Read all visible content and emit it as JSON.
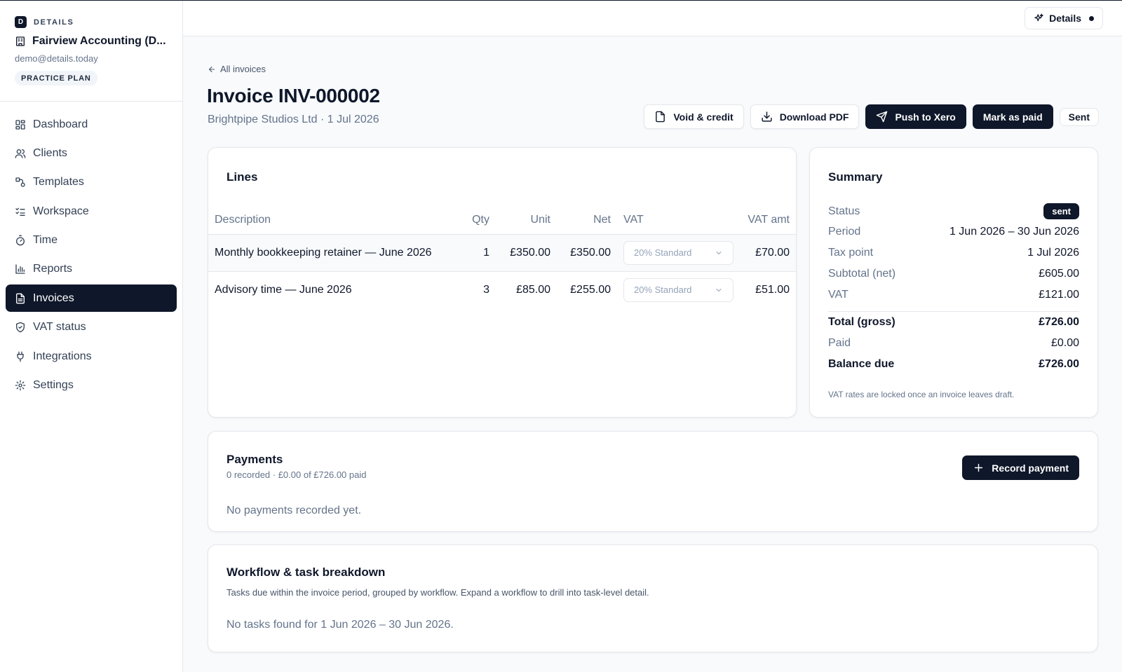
{
  "brand": {
    "logo_letter": "D",
    "name": "DETAILS"
  },
  "org": {
    "name": "Fairview Accounting (D...",
    "email": "demo@details.today",
    "plan": "PRACTICE PLAN"
  },
  "nav": [
    {
      "label": "Dashboard",
      "icon": "dashboard-icon"
    },
    {
      "label": "Clients",
      "icon": "users-icon"
    },
    {
      "label": "Templates",
      "icon": "templates-icon"
    },
    {
      "label": "Workspace",
      "icon": "checklist-icon"
    },
    {
      "label": "Time",
      "icon": "timer-icon"
    },
    {
      "label": "Reports",
      "icon": "bar-chart-icon"
    },
    {
      "label": "Invoices",
      "icon": "file-icon",
      "active": true
    },
    {
      "label": "VAT status",
      "icon": "shield-icon"
    },
    {
      "label": "Integrations",
      "icon": "plug-icon"
    },
    {
      "label": "Settings",
      "icon": "gear-icon"
    }
  ],
  "topbar": {
    "details_label": "Details"
  },
  "header": {
    "back_label": "All invoices",
    "title": "Invoice INV-000002",
    "subtitle": "Brightpipe Studios Ltd · 1 Jul 2026"
  },
  "actions": {
    "void_label": "Void & credit",
    "download_label": "Download PDF",
    "xero_label": "Push to Xero",
    "mark_paid_label": "Mark as paid",
    "status_label": "Sent"
  },
  "lines": {
    "title": "Lines",
    "columns": {
      "description": "Description",
      "qty": "Qty",
      "unit": "Unit",
      "net": "Net",
      "vat": "VAT",
      "vat_amt": "VAT amt"
    },
    "rows": [
      {
        "description": "Monthly bookkeeping retainer — June 2026",
        "qty": "1",
        "unit": "£350.00",
        "net": "£350.00",
        "vat": "20% Standard",
        "vat_amt": "£70.00"
      },
      {
        "description": "Advisory time — June 2026",
        "qty": "3",
        "unit": "£85.00",
        "net": "£255.00",
        "vat": "20% Standard",
        "vat_amt": "£51.00"
      }
    ]
  },
  "summary": {
    "title": "Summary",
    "status_label": "Status",
    "status_value": "sent",
    "period_label": "Period",
    "period_value": "1 Jun 2026 – 30 Jun 2026",
    "tax_point_label": "Tax point",
    "tax_point_value": "1 Jul 2026",
    "subtotal_label": "Subtotal (net)",
    "subtotal_value": "£605.00",
    "vat_label": "VAT",
    "vat_value": "£121.00",
    "total_label": "Total (gross)",
    "total_value": "£726.00",
    "paid_label": "Paid",
    "paid_value": "£0.00",
    "balance_label": "Balance due",
    "balance_value": "£726.00",
    "note": "VAT rates are locked once an invoice leaves draft."
  },
  "payments": {
    "title": "Payments",
    "meta": "0 recorded · £0.00 of £726.00 paid",
    "record_label": "Record payment",
    "empty": "No payments recorded yet."
  },
  "workflow": {
    "title": "Workflow & task breakdown",
    "meta": "Tasks due within the invoice period, grouped by workflow. Expand a workflow to drill into task-level detail.",
    "empty": "No tasks found for 1 Jun 2026 – 30 Jun 2026."
  },
  "colors": {
    "primary": "#0f172a",
    "muted": "#64748b",
    "border": "#e5e7eb",
    "background": "#f8fafc"
  }
}
